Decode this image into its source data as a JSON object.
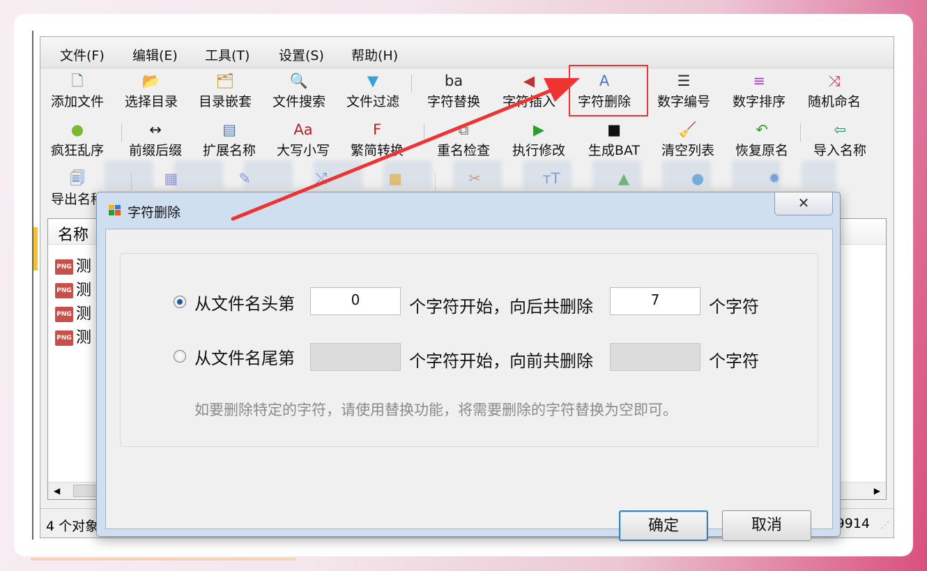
{
  "menu": [
    {
      "label": "文件(F)"
    },
    {
      "label": "编辑(E)"
    },
    {
      "label": "工具(T)"
    },
    {
      "label": "设置(S)"
    },
    {
      "label": "帮助(H)"
    }
  ],
  "toolbar_row1": [
    {
      "label": "添加文件",
      "icon": "add-file-icon",
      "glyph": "🗋",
      "color": "#3a8a3a"
    },
    {
      "label": "选择目录",
      "icon": "folder-open-icon",
      "glyph": "📂",
      "color": "#d9a520"
    },
    {
      "label": "目录嵌套",
      "icon": "nested-folder-icon",
      "glyph": "🗂",
      "color": "#c98a20"
    },
    {
      "label": "文件搜索",
      "icon": "search-icon",
      "glyph": "🔍",
      "color": "#2a6fc9"
    },
    {
      "label": "文件过滤",
      "icon": "filter-icon",
      "glyph": "▼",
      "color": "#3aa0d8"
    },
    {
      "label": "字符替换",
      "icon": "char-replace-icon",
      "glyph": "ba",
      "color": "#222"
    },
    {
      "label": "字符插入",
      "icon": "char-insert-icon",
      "glyph": "◀",
      "color": "#b33"
    },
    {
      "label": "字符删除",
      "icon": "char-delete-icon",
      "glyph": "A",
      "color": "#4a78c4"
    },
    {
      "label": "数字编号",
      "icon": "number-list-icon",
      "glyph": "☰",
      "color": "#222"
    },
    {
      "label": "数字排序",
      "icon": "sort-icon",
      "glyph": "≡",
      "color": "#a040c0"
    },
    {
      "label": "随机命名",
      "icon": "shuffle-icon",
      "glyph": "⤨",
      "color": "#d42a6a"
    }
  ],
  "toolbar_row2": [
    {
      "label": "疯狂乱序",
      "icon": "android-icon",
      "glyph": "●",
      "color": "#7cb82f"
    },
    {
      "label": "前缀后缀",
      "icon": "prefix-suffix-icon",
      "glyph": "↔",
      "color": "#111"
    },
    {
      "label": "扩展名称",
      "icon": "extension-icon",
      "glyph": "▤",
      "color": "#4a78c4"
    },
    {
      "label": "大写小写",
      "icon": "case-icon",
      "glyph": "Aa",
      "color": "#b0202a"
    },
    {
      "label": "繁简转换",
      "icon": "traditional-simplified-icon",
      "glyph": "F",
      "color": "#c41e1e"
    },
    {
      "label": "重名检查",
      "icon": "duplicate-check-icon",
      "glyph": "⧉",
      "color": "#777"
    },
    {
      "label": "执行修改",
      "icon": "execute-icon",
      "glyph": "▶",
      "color": "#2aa02a"
    },
    {
      "label": "生成BAT",
      "icon": "terminal-icon",
      "glyph": "■",
      "color": "#111"
    },
    {
      "label": "清空列表",
      "icon": "clear-icon",
      "glyph": "🧹",
      "color": "#d24a2a"
    },
    {
      "label": "恢复原名",
      "icon": "undo-icon",
      "glyph": "↶",
      "color": "#2aa02a"
    },
    {
      "label": "导入名称",
      "icon": "import-icon",
      "glyph": "⇦",
      "color": "#2a8a6a"
    }
  ],
  "toolbar_row3": [
    {
      "label": "导出名称",
      "icon": "export-icon",
      "glyph": "🗐",
      "color": "#3a6ab8"
    },
    {
      "label": "",
      "icon": "grid-icon",
      "glyph": "▦",
      "color": "#4a5ac4"
    },
    {
      "label": "",
      "icon": "edit-icon",
      "glyph": "✎",
      "color": "#4a5ac4"
    },
    {
      "label": "",
      "icon": "random-icon",
      "glyph": "⤭",
      "color": "#4a5ac4"
    },
    {
      "label": "",
      "icon": "folder-icon",
      "glyph": "■",
      "color": "#f2b31a"
    },
    {
      "label": "",
      "icon": "tools-icon",
      "glyph": "✂",
      "color": "#c8702a"
    },
    {
      "label": "",
      "icon": "text-size-icon",
      "glyph": "ᴛT",
      "color": "#4a78c4"
    },
    {
      "label": "",
      "icon": "drive-icon",
      "glyph": "▲",
      "color": "#2aa02a"
    },
    {
      "label": "",
      "icon": "bell-icon",
      "glyph": "●",
      "color": "#3a90d8"
    },
    {
      "label": "",
      "icon": "gear-icon",
      "glyph": "✹",
      "color": "#3a78d0"
    }
  ],
  "list": {
    "column_header": "名称",
    "rows": [
      "测",
      "测",
      "测",
      "测"
    ]
  },
  "status": {
    "left": "4 个对象",
    "right": "9914"
  },
  "dialog": {
    "title": "字符删除",
    "row1": {
      "label": "从文件名头第",
      "start_value": "0",
      "mid": "个字符开始，向后共删除",
      "count_value": "7",
      "suffix": "个字符",
      "selected": true
    },
    "row2": {
      "label": "从文件名尾第",
      "start_value": "",
      "mid": "个字符开始，向前共删除",
      "count_value": "",
      "suffix": "个字符",
      "selected": false
    },
    "hint": "如要删除特定的字符，请使用替换功能，将需要删除的字符替换为空即可。",
    "ok_label": "确定",
    "cancel_label": "取消"
  },
  "colors": {
    "highlight": "#ee3333",
    "arrow": "#ee3333",
    "primary_border": "#3c7fb1"
  }
}
